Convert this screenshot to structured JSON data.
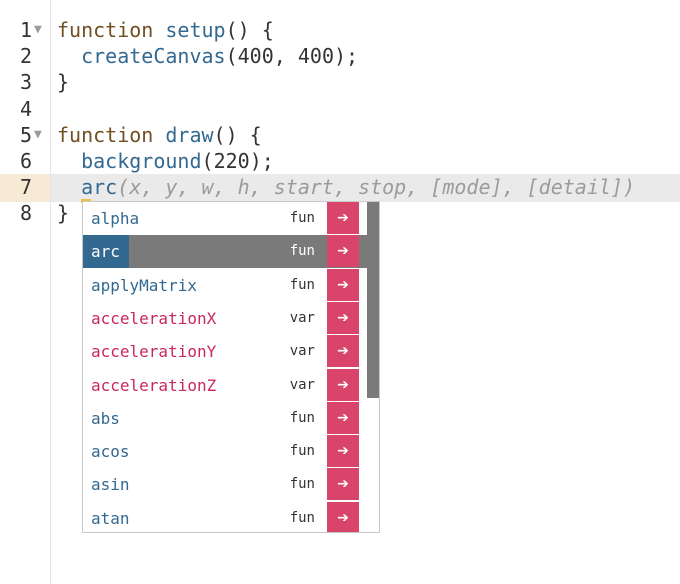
{
  "editor": {
    "active_line": 7,
    "lines": [
      {
        "num": "1",
        "fold": true,
        "parts": [
          [
            "kw",
            "function "
          ],
          [
            "fn",
            "setup"
          ],
          [
            "punc",
            "() {"
          ]
        ]
      },
      {
        "num": "2",
        "fold": false,
        "parts": [
          [
            "punc",
            "  "
          ],
          [
            "fn",
            "createCanvas"
          ],
          [
            "punc",
            "("
          ],
          [
            "num",
            "400"
          ],
          [
            "punc",
            ", "
          ],
          [
            "num",
            "400"
          ],
          [
            "punc",
            ");"
          ]
        ]
      },
      {
        "num": "3",
        "fold": false,
        "parts": [
          [
            "punc",
            "}"
          ]
        ]
      },
      {
        "num": "4",
        "fold": false,
        "parts": []
      },
      {
        "num": "5",
        "fold": true,
        "parts": [
          [
            "kw",
            "function "
          ],
          [
            "fn",
            "draw"
          ],
          [
            "punc",
            "() {"
          ]
        ]
      },
      {
        "num": "6",
        "fold": false,
        "parts": [
          [
            "punc",
            "  "
          ],
          [
            "fn",
            "background"
          ],
          [
            "punc",
            "("
          ],
          [
            "num",
            "220"
          ],
          [
            "punc",
            ");"
          ]
        ]
      },
      {
        "num": "7",
        "fold": false,
        "parts": [
          [
            "punc",
            "  "
          ],
          [
            "fn",
            "arc"
          ],
          [
            "hint",
            "(x, y, w, h, start, stop, [mode], [detail])"
          ]
        ]
      },
      {
        "num": "8",
        "fold": false,
        "parts": [
          [
            "punc",
            "}"
          ]
        ]
      }
    ],
    "fold_icon": "triangle-down-icon"
  },
  "autocomplete": {
    "selected_index": 1,
    "arrow_icon": "arrow-right-icon",
    "arrow_glyph": "➔",
    "colors": {
      "fun": "#336991",
      "var": "#c8285f",
      "arrow_bg": "#d9446b"
    },
    "items": [
      {
        "name": "alpha",
        "type": "fun"
      },
      {
        "name": "arc",
        "type": "fun"
      },
      {
        "name": "applyMatrix",
        "type": "fun"
      },
      {
        "name": "accelerationX",
        "type": "var"
      },
      {
        "name": "accelerationY",
        "type": "var"
      },
      {
        "name": "accelerationZ",
        "type": "var"
      },
      {
        "name": "abs",
        "type": "fun"
      },
      {
        "name": "acos",
        "type": "fun"
      },
      {
        "name": "asin",
        "type": "fun"
      },
      {
        "name": "atan",
        "type": "fun"
      }
    ]
  }
}
